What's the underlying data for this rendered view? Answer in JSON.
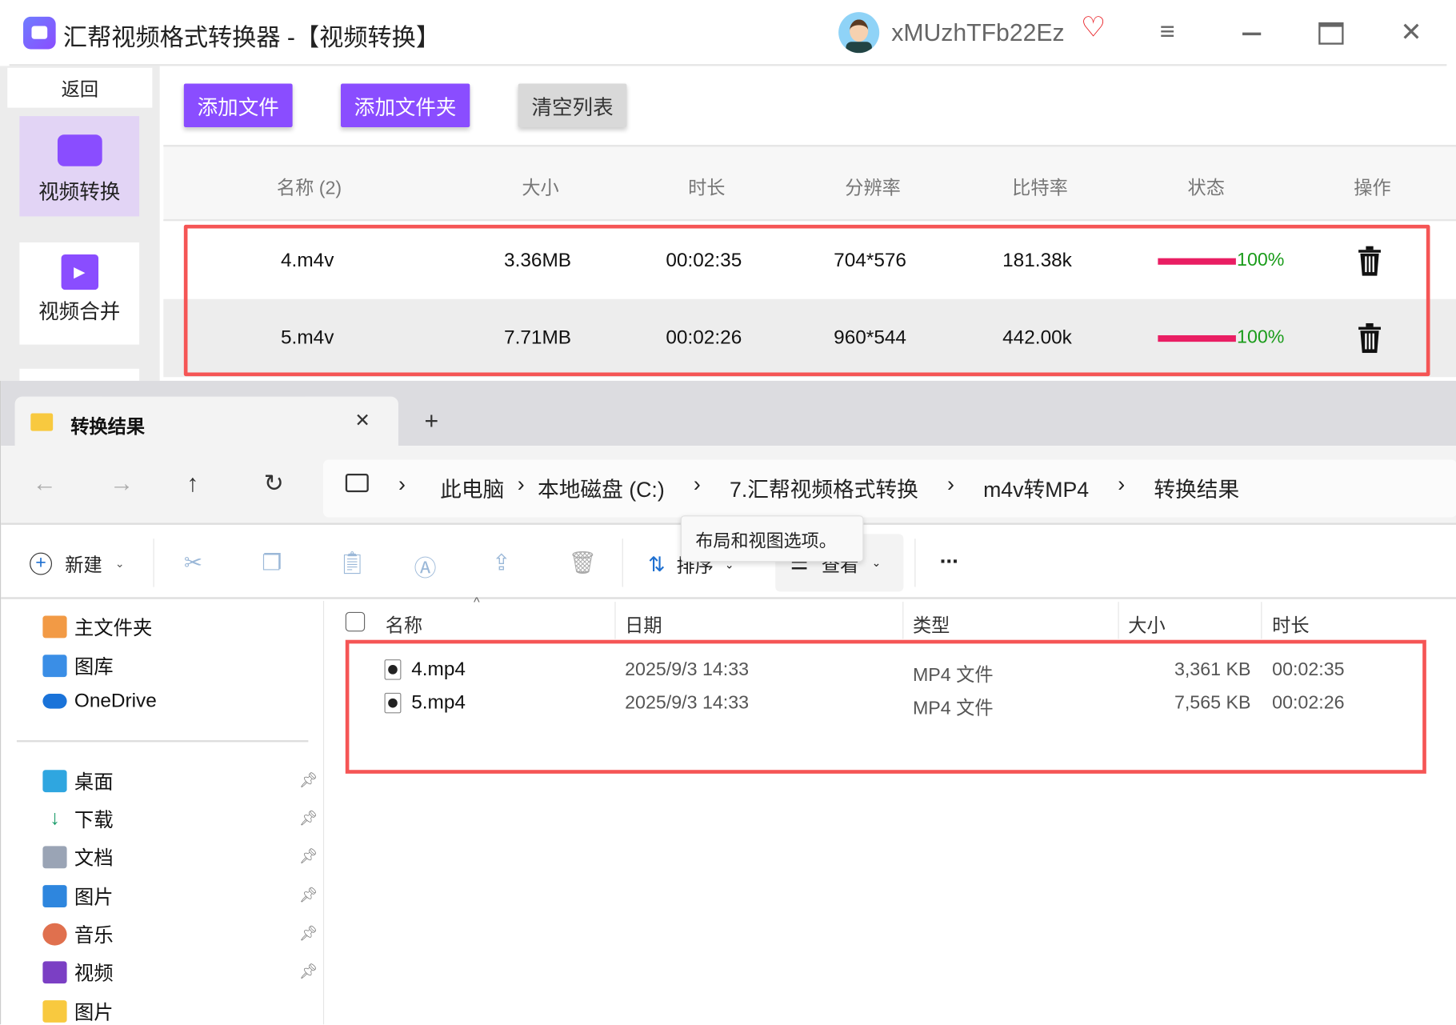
{
  "app": {
    "title": "汇帮视频格式转换器 -【视频转换】",
    "username": "xMUzhTFb22Ez",
    "back_label": "返回",
    "sidebar": [
      {
        "label": "视频转换"
      },
      {
        "label": "视频合并"
      }
    ],
    "buttons": {
      "add_file": "添加文件",
      "add_folder": "添加文件夹",
      "clear_list": "清空列表"
    },
    "columns": [
      "名称 (2)",
      "大小",
      "时长",
      "分辨率",
      "比特率",
      "状态",
      "操作"
    ],
    "rows": [
      {
        "name": "4.m4v",
        "size": "3.36MB",
        "duration": "00:02:35",
        "resolution": "704*576",
        "bitrate": "181.38k",
        "progress": 100,
        "progress_label": "100%"
      },
      {
        "name": "5.m4v",
        "size": "7.71MB",
        "duration": "00:02:26",
        "resolution": "960*544",
        "bitrate": "442.00k",
        "progress": 100,
        "progress_label": "100%"
      }
    ],
    "colors": {
      "accent": "#8a4dff",
      "progress": "#e91e63",
      "highlight": "#f55555"
    }
  },
  "explorer": {
    "tab_title": "转换结果",
    "breadcrumb": [
      "此电脑",
      "本地磁盘 (C:)",
      "7.汇帮视频格式转换",
      "m4v转MP4",
      "转换结果"
    ],
    "toolbar": {
      "new": "新建",
      "sort": "排序",
      "view": "查看",
      "more": "..."
    },
    "tooltip": "布局和视图选项。",
    "nav_top": [
      "主文件夹",
      "图库",
      "OneDrive"
    ],
    "nav_pinned": [
      "桌面",
      "下载",
      "文档",
      "图片",
      "音乐",
      "视频",
      "图片"
    ],
    "columns": [
      "名称",
      "日期",
      "类型",
      "大小",
      "时长"
    ],
    "files": [
      {
        "name": "4.mp4",
        "date": "2025/9/3 14:33",
        "type": "MP4 文件",
        "size": "3,361 KB",
        "duration": "00:02:35"
      },
      {
        "name": "5.mp4",
        "date": "2025/9/3 14:33",
        "type": "MP4 文件",
        "size": "7,565 KB",
        "duration": "00:02:26"
      }
    ]
  }
}
